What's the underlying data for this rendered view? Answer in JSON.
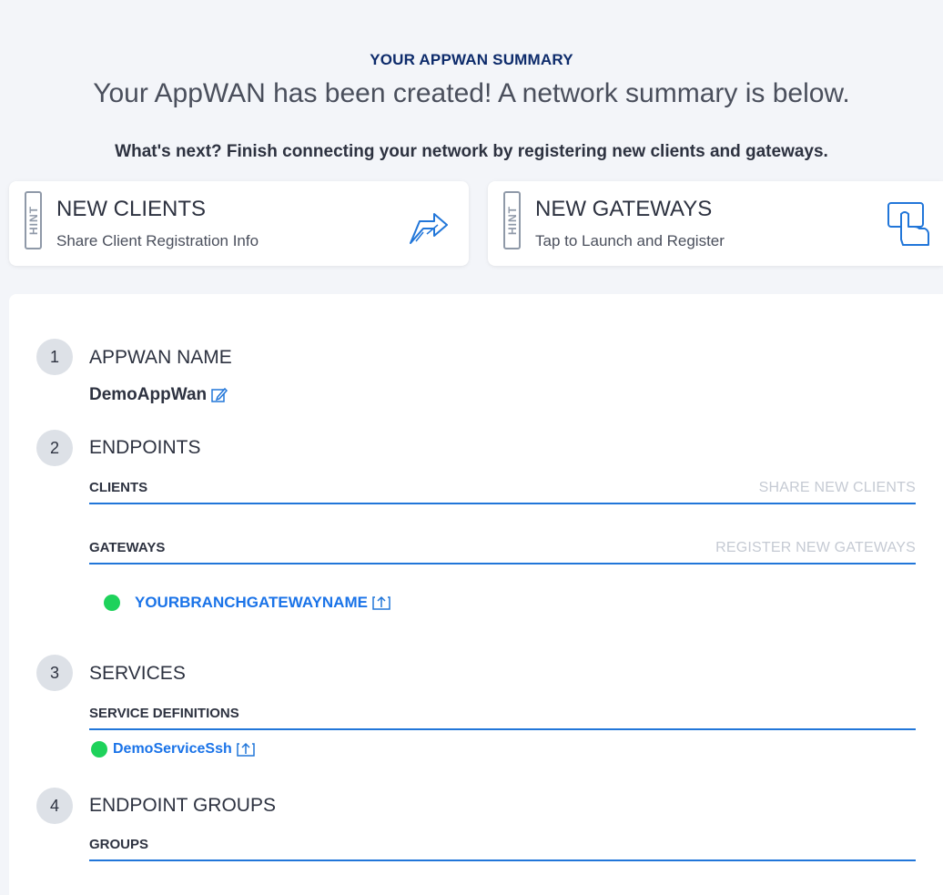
{
  "header": {
    "heading": "YOUR APPWAN SUMMARY",
    "subtitle": "Your AppWAN has been created! A network summary is below.",
    "next": "What's next? Finish connecting your network by registering new clients and gateways."
  },
  "hints": [
    {
      "badge": "HINT",
      "title": "NEW CLIENTS",
      "subtitle": "Share Client Registration Info",
      "icon": "share-arrow-icon"
    },
    {
      "badge": "HINT",
      "title": "NEW GATEWAYS",
      "subtitle": "Tap to Launch and Register",
      "icon": "tap-hand-icon"
    }
  ],
  "steps": [
    {
      "number": "1",
      "title": "APPWAN NAME",
      "value": "DemoAppWan"
    },
    {
      "number": "2",
      "title": "ENDPOINTS",
      "clients_label": "CLIENTS",
      "clients_action": "SHARE NEW CLIENTS",
      "gateways_label": "GATEWAYS",
      "gateways_action": "REGISTER NEW GATEWAYS",
      "gateways": [
        "YOURBRANCHGATEWAYNAME"
      ]
    },
    {
      "number": "3",
      "title": "SERVICES",
      "definitions_label": "SERVICE DEFINITIONS",
      "services": [
        "DemoServiceSsh"
      ]
    },
    {
      "number": "4",
      "title": "ENDPOINT GROUPS",
      "groups_label": "GROUPS"
    }
  ],
  "colors": {
    "accent": "#2176d9",
    "link": "#1a73e8",
    "status_green": "#1ed25b",
    "heading": "#0d2b6b"
  }
}
